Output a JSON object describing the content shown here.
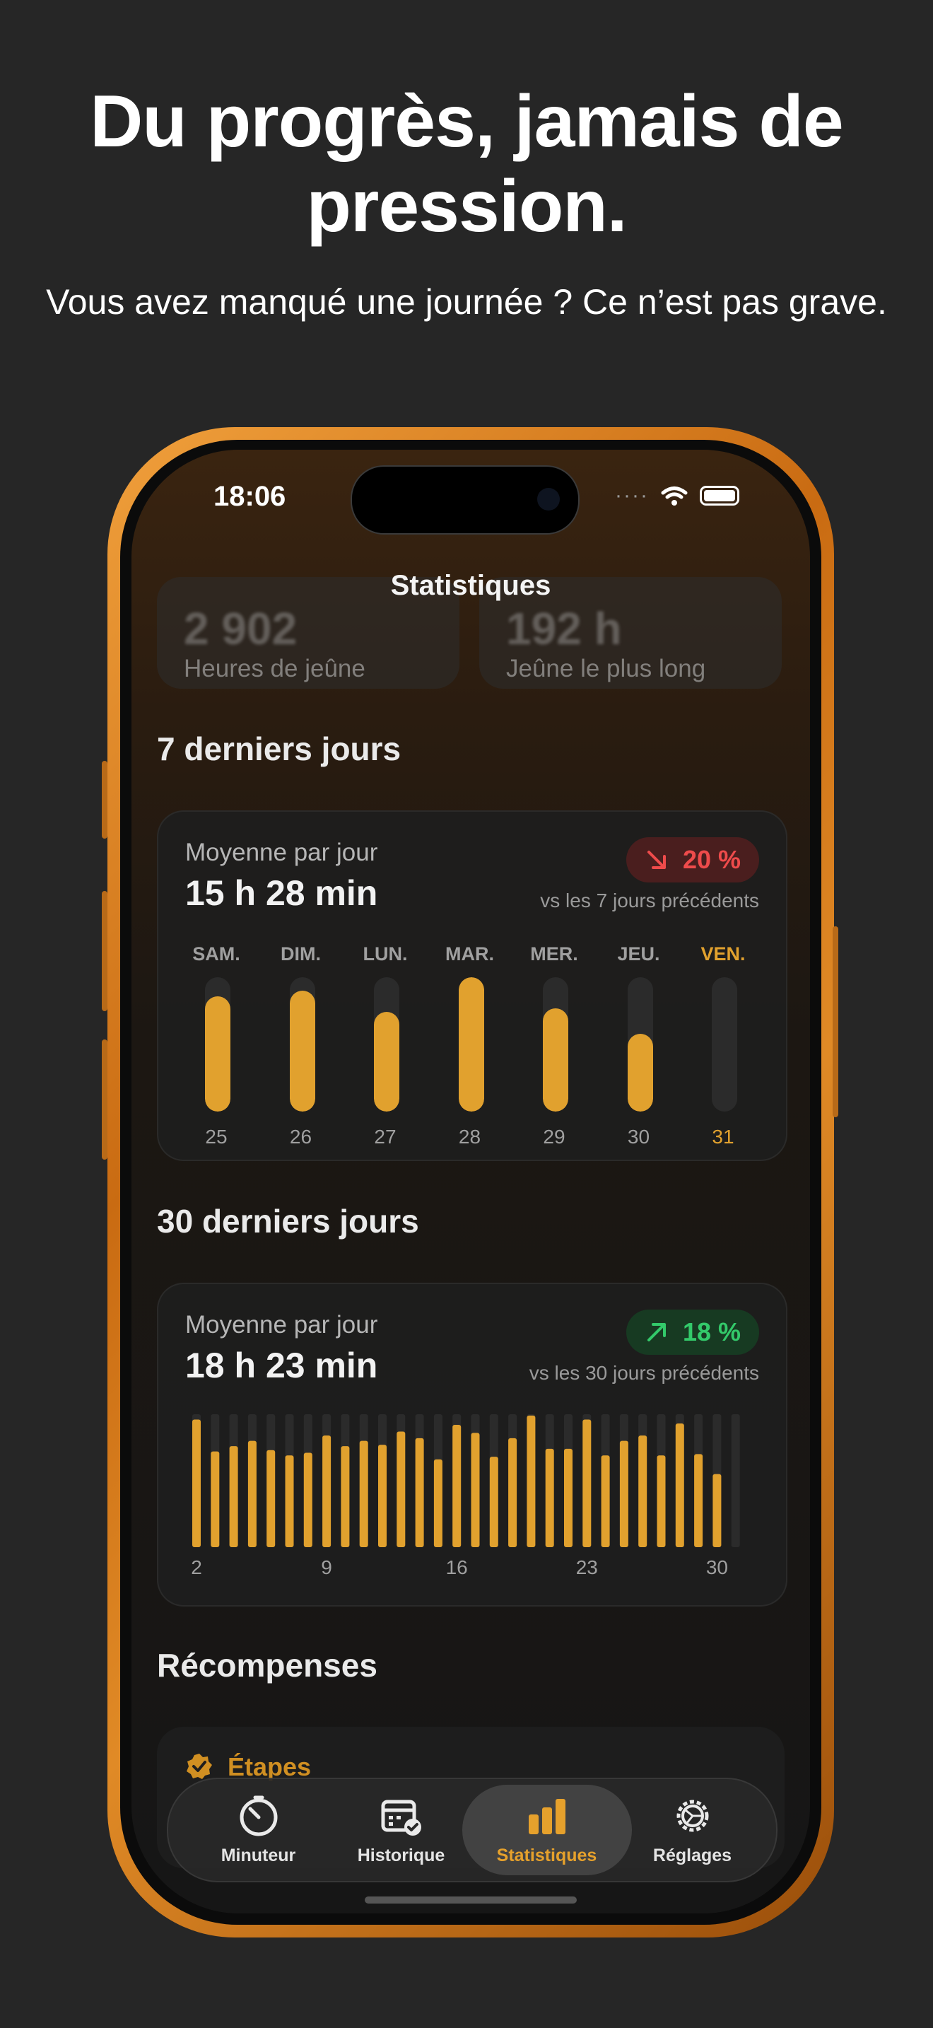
{
  "headline": "Du progrès, jamais de pression.",
  "subline": "Vous avez manqué une journée ? Ce n’est pas grave.",
  "status": {
    "time": "18:06",
    "dots": "····"
  },
  "nav_title": "Statistiques",
  "tiles": [
    {
      "value": "2 902",
      "label": "Heures de jeûne"
    },
    {
      "value": "192 h",
      "label": "Jeûne le plus long"
    }
  ],
  "week": {
    "heading": "7 derniers jours",
    "label": "Moyenne par jour",
    "value": "15 h 28 min",
    "delta": "20 %",
    "delta_direction": "down",
    "delta_color": "#ee4b4b",
    "vs": "vs les 7 jours précédents",
    "bar_color": "#e1a12e",
    "today_color": "#e1a12e",
    "days": [
      {
        "name": "SAM.",
        "num": "25",
        "fraction": 0.86
      },
      {
        "name": "DIM.",
        "num": "26",
        "fraction": 0.9
      },
      {
        "name": "LUN.",
        "num": "27",
        "fraction": 0.74
      },
      {
        "name": "MAR.",
        "num": "28",
        "fraction": 1.0
      },
      {
        "name": "MER.",
        "num": "29",
        "fraction": 0.77
      },
      {
        "name": "JEU.",
        "num": "30",
        "fraction": 0.58
      },
      {
        "name": "VEN.",
        "num": "31",
        "fraction": 0.0,
        "today": true
      }
    ]
  },
  "month": {
    "heading": "30 derniers jours",
    "label": "Moyenne par jour",
    "value": "18 h 23 min",
    "delta": "18 %",
    "delta_direction": "up",
    "delta_color": "#33c96a",
    "vs": "vs les 30 jours précédents",
    "tick_labels": [
      "2",
      "9",
      "16",
      "23",
      "30"
    ],
    "tick_days": [
      2,
      9,
      16,
      23,
      30
    ],
    "first_day": 2,
    "fractions": [
      0.96,
      0.72,
      0.76,
      0.8,
      0.73,
      0.69,
      0.71,
      0.84,
      0.76,
      0.8,
      0.77,
      0.87,
      0.82,
      0.66,
      0.92,
      0.86,
      0.68,
      0.82,
      0.99,
      0.74,
      0.74,
      0.96,
      0.69,
      0.8,
      0.84,
      0.69,
      0.93,
      0.7,
      0.55,
      0.0
    ]
  },
  "rewards": {
    "heading": "Récompenses",
    "first_item": "Étapes"
  },
  "tabs": [
    {
      "label": "Minuteur",
      "icon": "timer-icon"
    },
    {
      "label": "Historique",
      "icon": "calendar-check-icon"
    },
    {
      "label": "Statistiques",
      "icon": "bar-chart-icon",
      "active": true
    },
    {
      "label": "Réglages",
      "icon": "gear-icon"
    }
  ]
}
